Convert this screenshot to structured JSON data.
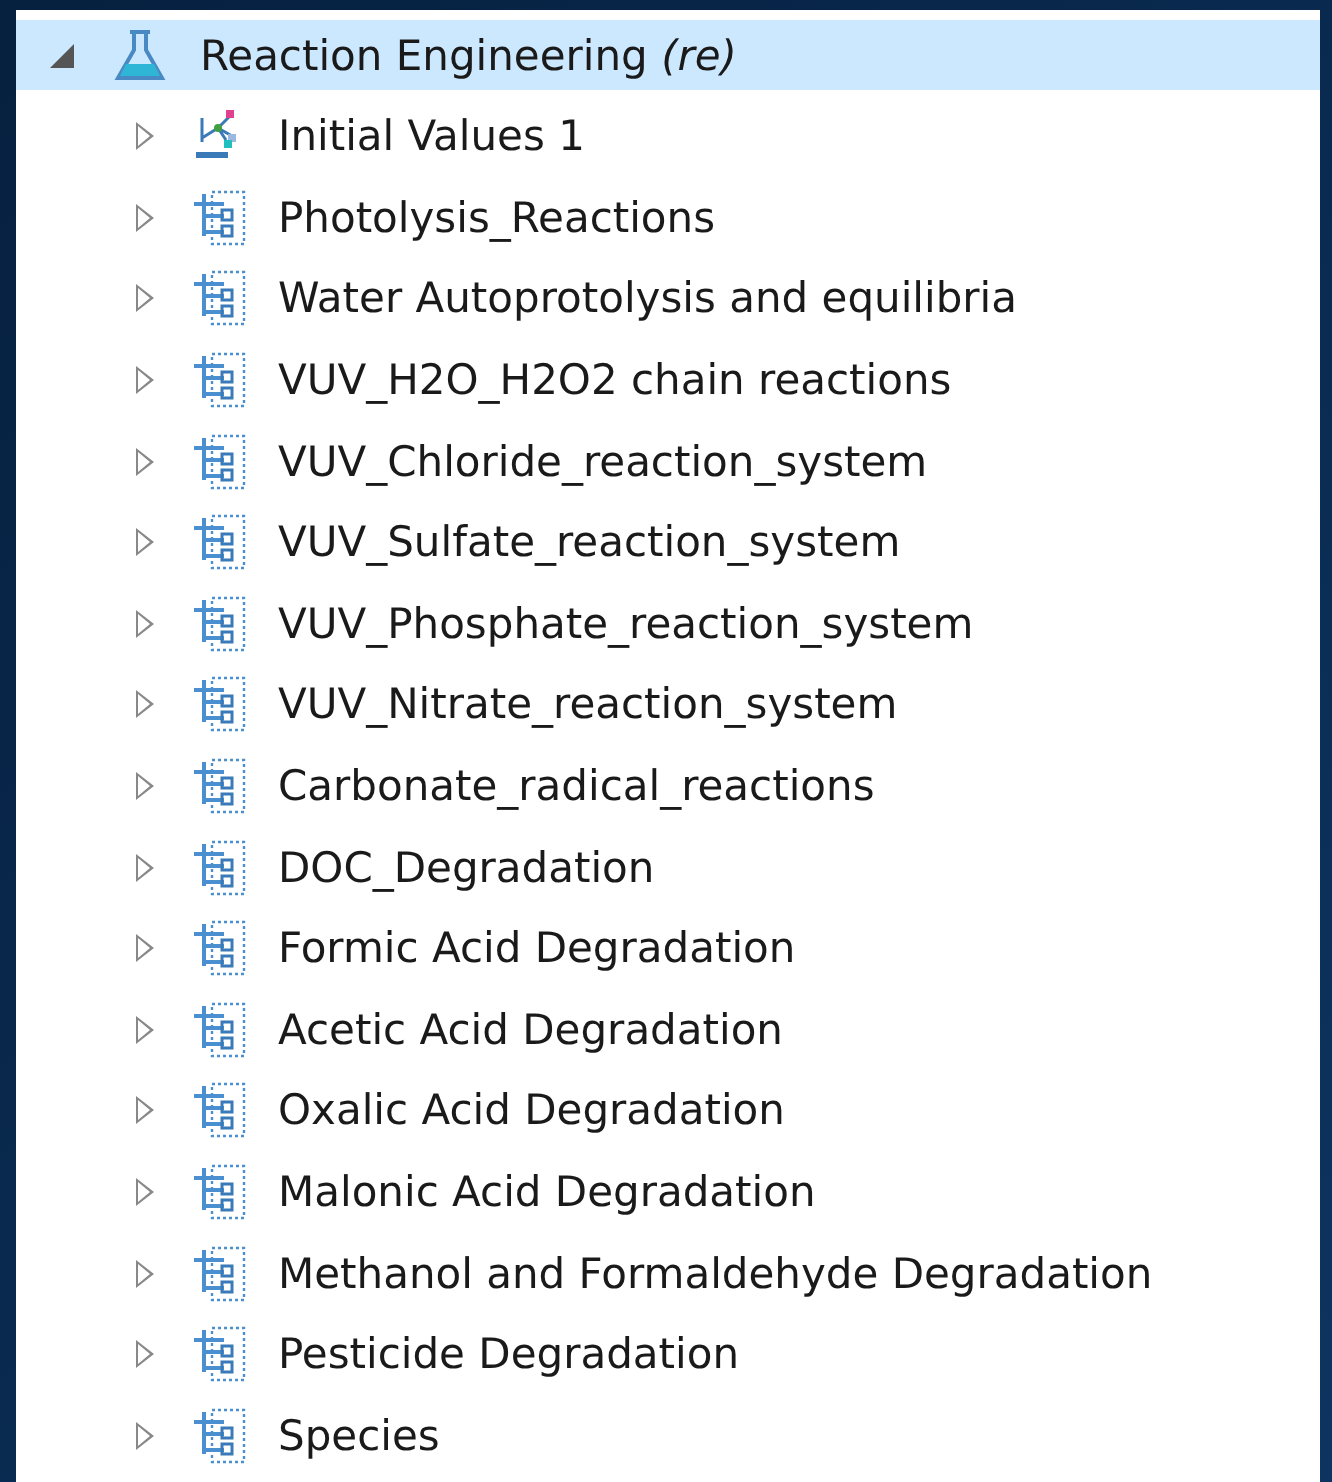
{
  "tree": {
    "label": "Reaction Engineering *(re)*",
    "kind": "flask",
    "expanded": true,
    "selected": true,
    "children": [
      {
        "label": "Initial Values 1",
        "kind": "initial",
        "expanded": false,
        "selected": false
      },
      {
        "label": "Photolysis_Reactions",
        "kind": "group",
        "expanded": false,
        "selected": false
      },
      {
        "label": "Water Autoprotolysis and equilibria",
        "kind": "group",
        "expanded": false,
        "selected": false
      },
      {
        "label": "VUV_H2O_H2O2 chain reactions",
        "kind": "group",
        "expanded": false,
        "selected": false
      },
      {
        "label": "VUV_Chloride_reaction_system",
        "kind": "group",
        "expanded": false,
        "selected": false
      },
      {
        "label": "VUV_Sulfate_reaction_system",
        "kind": "group",
        "expanded": false,
        "selected": false
      },
      {
        "label": "VUV_Phosphate_reaction_system",
        "kind": "group",
        "expanded": false,
        "selected": false
      },
      {
        "label": "VUV_Nitrate_reaction_system",
        "kind": "group",
        "expanded": false,
        "selected": false
      },
      {
        "label": "Carbonate_radical_reactions",
        "kind": "group",
        "expanded": false,
        "selected": false
      },
      {
        "label": "DOC_Degradation",
        "kind": "group",
        "expanded": false,
        "selected": false
      },
      {
        "label": "Formic Acid Degradation",
        "kind": "group",
        "expanded": false,
        "selected": false
      },
      {
        "label": "Acetic Acid Degradation",
        "kind": "group",
        "expanded": false,
        "selected": false
      },
      {
        "label": "Oxalic Acid Degradation",
        "kind": "group",
        "expanded": false,
        "selected": false
      },
      {
        "label": "Malonic Acid Degradation",
        "kind": "group",
        "expanded": false,
        "selected": false
      },
      {
        "label": "Methanol and Formaldehyde Degradation",
        "kind": "group",
        "expanded": false,
        "selected": false
      },
      {
        "label": "Pesticide Degradation",
        "kind": "group",
        "expanded": false,
        "selected": false
      },
      {
        "label": "Species",
        "kind": "group",
        "expanded": false,
        "selected": false
      }
    ]
  }
}
